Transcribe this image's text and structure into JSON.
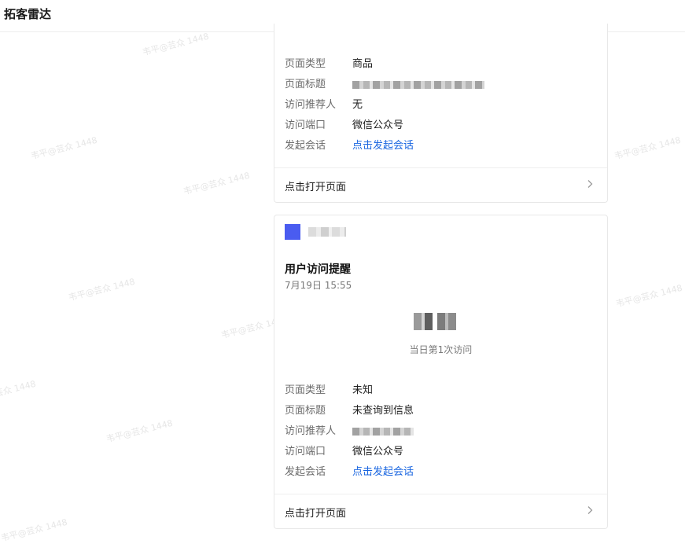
{
  "app": {
    "title": "拓客雷达"
  },
  "watermark": {
    "text": "韦平@芸众 1448"
  },
  "card1": {
    "rows": [
      {
        "label": "页面类型",
        "value": "商品"
      },
      {
        "label": "页面标题",
        "value": ""
      },
      {
        "label": "访问推荐人",
        "value": "无"
      },
      {
        "label": "访问端口",
        "value": "微信公众号"
      },
      {
        "label": "发起会话",
        "value": "点击发起会话"
      }
    ],
    "open_label": "点击打开页面"
  },
  "card2": {
    "notice_title": "用户访问提醒",
    "notice_time": "7月19日 15:55",
    "visit_caption": "当日第1次访问",
    "rows": [
      {
        "label": "页面类型",
        "value": "未知"
      },
      {
        "label": "页面标题",
        "value": "未查询到信息"
      },
      {
        "label": "访问推荐人",
        "value": ""
      },
      {
        "label": "访问端口",
        "value": "微信公众号"
      },
      {
        "label": "发起会话",
        "value": "点击发起会话"
      }
    ],
    "open_label": "点击打开页面"
  },
  "icons": {
    "chevron": "chevron-right-icon",
    "app_logo": "app-logo-icon"
  },
  "colors": {
    "link": "#1a66e0",
    "logo": "#4a5cf0",
    "label": "#6b6b6b"
  }
}
